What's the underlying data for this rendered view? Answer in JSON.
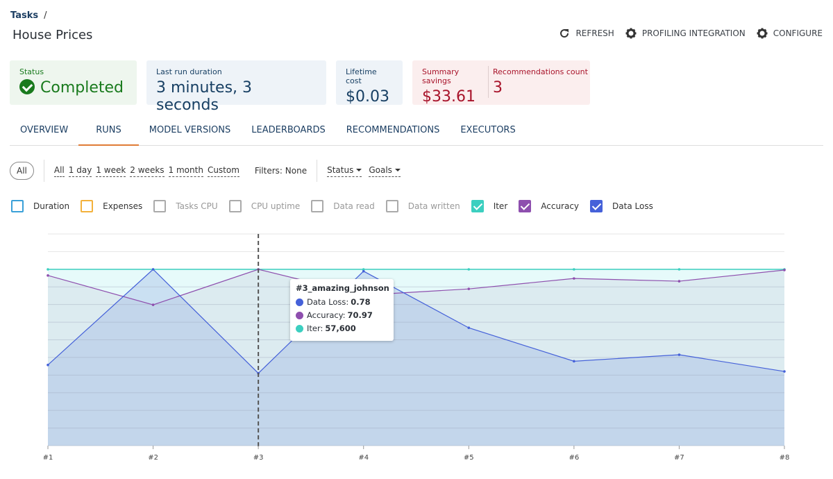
{
  "breadcrumb": {
    "root": "Tasks",
    "separator": "/"
  },
  "page_title": "House Prices",
  "actions": [
    {
      "label": "REFRESH",
      "icon": "refresh-icon"
    },
    {
      "label": "PROFILING INTEGRATION",
      "icon": "gear-icon"
    },
    {
      "label": "CONFIGURE",
      "icon": "gear-icon"
    }
  ],
  "cards": {
    "status": {
      "label": "Status",
      "value": "Completed"
    },
    "duration": {
      "label": "Last run duration",
      "value": "3 minutes, 3 seconds"
    },
    "cost": {
      "label": "Lifetime cost",
      "value": "$0.03"
    },
    "savings": {
      "label": "Summary savings",
      "value": "$33.61"
    },
    "recs": {
      "label": "Recommendations count",
      "value": "3"
    }
  },
  "tabs": [
    "OVERVIEW",
    "RUNS",
    "MODEL VERSIONS",
    "LEADERBOARDS",
    "RECOMMENDATIONS",
    "EXECUTORS"
  ],
  "active_tab": "RUNS",
  "filters": {
    "pill": "All",
    "ranges": [
      "All",
      "1 day",
      "1 week",
      "2 weeks",
      "1 month",
      "Custom"
    ],
    "filters_label": "Filters:",
    "filters_value": "None",
    "dropdowns": [
      "Status",
      "Goals"
    ]
  },
  "legend": [
    {
      "label": "Duration",
      "color": "#3aa0d8",
      "checked": false,
      "muted": false
    },
    {
      "label": "Expenses",
      "color": "#f3b13b",
      "checked": false,
      "muted": false
    },
    {
      "label": "Tasks CPU",
      "color": "#aaaaaa",
      "checked": false,
      "muted": true
    },
    {
      "label": "CPU uptime",
      "color": "#aaaaaa",
      "checked": false,
      "muted": true
    },
    {
      "label": "Data read",
      "color": "#aaaaaa",
      "checked": false,
      "muted": true
    },
    {
      "label": "Data written",
      "color": "#aaaaaa",
      "checked": false,
      "muted": true
    },
    {
      "label": "Iter",
      "color": "#3ccfc0",
      "checked": true,
      "muted": false
    },
    {
      "label": "Accuracy",
      "color": "#8e4fae",
      "checked": true,
      "muted": false
    },
    {
      "label": "Data Loss",
      "color": "#4561d9",
      "checked": true,
      "muted": false
    }
  ],
  "tooltip": {
    "title": "#3_amazing_johnson",
    "rows": [
      {
        "label": "Data Loss:",
        "value": "0.78",
        "color": "#4561d9"
      },
      {
        "label": "Accuracy:",
        "value": "70.97",
        "color": "#8e4fae"
      },
      {
        "label": "Iter:",
        "value": "57,600",
        "color": "#3ccfc0"
      }
    ]
  },
  "chart_data": {
    "type": "area",
    "categories": [
      "#1",
      "#2",
      "#3",
      "#4",
      "#5",
      "#6",
      "#7",
      "#8"
    ],
    "highlighted_category": "#3",
    "grid": true,
    "series": [
      {
        "name": "Iter",
        "color": "#3ccfc0",
        "values": [
          57600,
          57600,
          57600,
          57600,
          57600,
          57600,
          57600,
          57600
        ]
      },
      {
        "name": "Accuracy",
        "color": "#8e4fae",
        "values": [
          68.5,
          56.7,
          70.97,
          60.6,
          63.1,
          67.3,
          66.2,
          70.7
        ]
      },
      {
        "name": "Data Loss",
        "color": "#4561d9",
        "values": [
          0.87,
          1.9,
          0.78,
          1.88,
          1.27,
          0.91,
          0.98,
          0.8
        ]
      }
    ]
  }
}
